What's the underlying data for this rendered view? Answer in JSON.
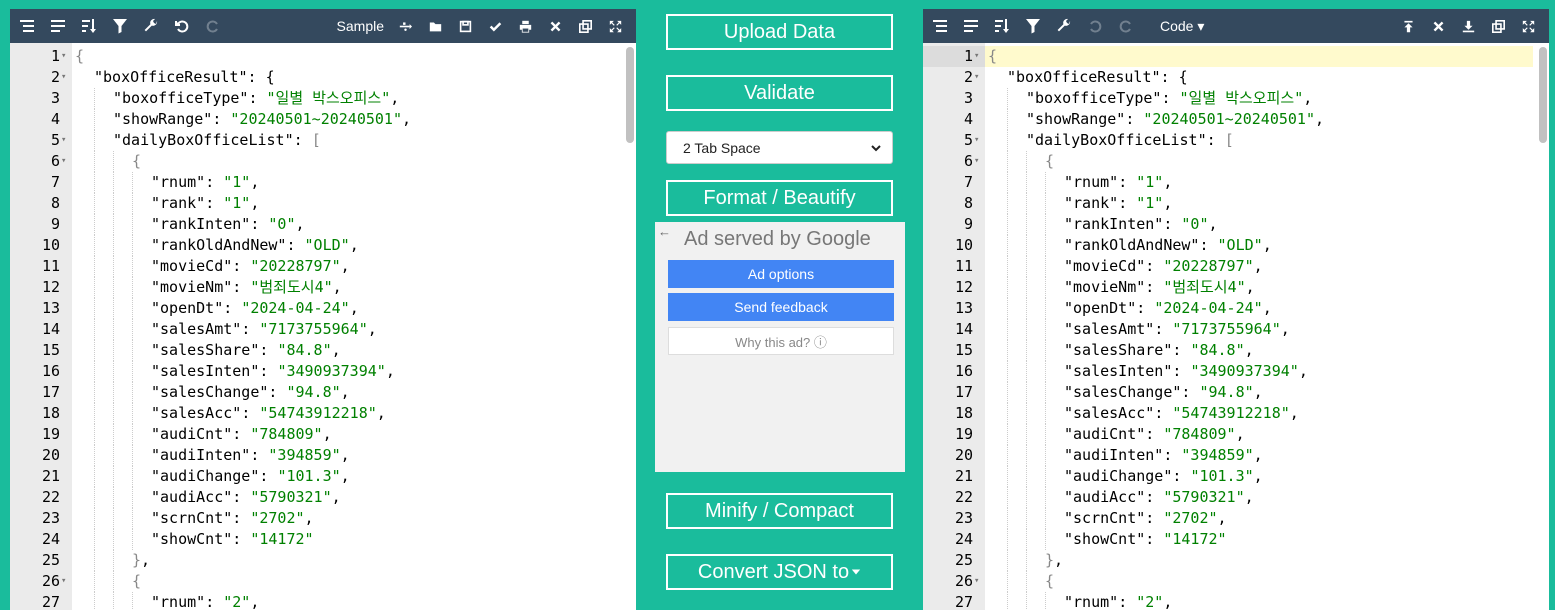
{
  "left_editor": {
    "title": "Sample",
    "toolbar_icons": [
      "format-icon",
      "compact-icon",
      "sort-icon",
      "filter-icon",
      "repair-icon",
      "undo-icon",
      "redo-icon"
    ],
    "right_icons": [
      "usb-icon",
      "open-folder-icon",
      "save-icon",
      "check-icon",
      "print-icon",
      "close-icon",
      "copy-icon",
      "fullscreen-icon"
    ]
  },
  "right_editor": {
    "mode_label": "Code",
    "toolbar_icons": [
      "format-icon",
      "compact-icon",
      "sort-icon",
      "filter-icon",
      "repair-icon",
      "undo-icon",
      "redo-icon"
    ],
    "right_icons": [
      "upload-icon",
      "close-icon",
      "download-icon",
      "copy-icon",
      "fullscreen-icon"
    ]
  },
  "middle": {
    "upload_label": "Upload Data",
    "validate_label": "Validate",
    "tab_select_value": "2 Tab Space",
    "format_label": "Format / Beautify",
    "minify_label": "Minify / Compact",
    "convert_label": "Convert JSON to"
  },
  "ad": {
    "title": "Ad served by Google",
    "options_label": "Ad options",
    "feedback_label": "Send feedback",
    "why_label": "Why this ad? ⓘ"
  },
  "colors": {
    "background": "#1abc9c",
    "toolbar": "#34495e",
    "string": "#008000",
    "ad_button": "#4285f4"
  },
  "code_lines": [
    {
      "n": "1",
      "fold": true,
      "indent": 0,
      "parts": [
        [
          "br",
          "{"
        ]
      ]
    },
    {
      "n": "2",
      "fold": true,
      "indent": 1,
      "parts": [
        [
          "k",
          "\"boxOfficeResult\""
        ],
        [
          "p",
          ": {"
        ]
      ]
    },
    {
      "n": "3",
      "fold": false,
      "indent": 2,
      "parts": [
        [
          "k",
          "\"boxofficeType\""
        ],
        [
          "p",
          ": "
        ],
        [
          "s",
          "\"일별 박스오피스\""
        ],
        [
          "p",
          ","
        ]
      ]
    },
    {
      "n": "4",
      "fold": false,
      "indent": 2,
      "parts": [
        [
          "k",
          "\"showRange\""
        ],
        [
          "p",
          ": "
        ],
        [
          "s",
          "\"20240501~20240501\""
        ],
        [
          "p",
          ","
        ]
      ]
    },
    {
      "n": "5",
      "fold": true,
      "indent": 2,
      "parts": [
        [
          "k",
          "\"dailyBoxOfficeList\""
        ],
        [
          "p",
          ": "
        ],
        [
          "br",
          "["
        ]
      ]
    },
    {
      "n": "6",
      "fold": true,
      "indent": 3,
      "parts": [
        [
          "br",
          "{"
        ]
      ]
    },
    {
      "n": "7",
      "fold": false,
      "indent": 4,
      "parts": [
        [
          "k",
          "\"rnum\""
        ],
        [
          "p",
          ": "
        ],
        [
          "s",
          "\"1\""
        ],
        [
          "p",
          ","
        ]
      ]
    },
    {
      "n": "8",
      "fold": false,
      "indent": 4,
      "parts": [
        [
          "k",
          "\"rank\""
        ],
        [
          "p",
          ": "
        ],
        [
          "s",
          "\"1\""
        ],
        [
          "p",
          ","
        ]
      ]
    },
    {
      "n": "9",
      "fold": false,
      "indent": 4,
      "parts": [
        [
          "k",
          "\"rankInten\""
        ],
        [
          "p",
          ": "
        ],
        [
          "s",
          "\"0\""
        ],
        [
          "p",
          ","
        ]
      ]
    },
    {
      "n": "10",
      "fold": false,
      "indent": 4,
      "parts": [
        [
          "k",
          "\"rankOldAndNew\""
        ],
        [
          "p",
          ": "
        ],
        [
          "s",
          "\"OLD\""
        ],
        [
          "p",
          ","
        ]
      ]
    },
    {
      "n": "11",
      "fold": false,
      "indent": 4,
      "parts": [
        [
          "k",
          "\"movieCd\""
        ],
        [
          "p",
          ": "
        ],
        [
          "s",
          "\"20228797\""
        ],
        [
          "p",
          ","
        ]
      ]
    },
    {
      "n": "12",
      "fold": false,
      "indent": 4,
      "parts": [
        [
          "k",
          "\"movieNm\""
        ],
        [
          "p",
          ": "
        ],
        [
          "s",
          "\"범죄도시4\""
        ],
        [
          "p",
          ","
        ]
      ]
    },
    {
      "n": "13",
      "fold": false,
      "indent": 4,
      "parts": [
        [
          "k",
          "\"openDt\""
        ],
        [
          "p",
          ": "
        ],
        [
          "s",
          "\"2024-04-24\""
        ],
        [
          "p",
          ","
        ]
      ]
    },
    {
      "n": "14",
      "fold": false,
      "indent": 4,
      "parts": [
        [
          "k",
          "\"salesAmt\""
        ],
        [
          "p",
          ": "
        ],
        [
          "s",
          "\"7173755964\""
        ],
        [
          "p",
          ","
        ]
      ]
    },
    {
      "n": "15",
      "fold": false,
      "indent": 4,
      "parts": [
        [
          "k",
          "\"salesShare\""
        ],
        [
          "p",
          ": "
        ],
        [
          "s",
          "\"84.8\""
        ],
        [
          "p",
          ","
        ]
      ]
    },
    {
      "n": "16",
      "fold": false,
      "indent": 4,
      "parts": [
        [
          "k",
          "\"salesInten\""
        ],
        [
          "p",
          ": "
        ],
        [
          "s",
          "\"3490937394\""
        ],
        [
          "p",
          ","
        ]
      ]
    },
    {
      "n": "17",
      "fold": false,
      "indent": 4,
      "parts": [
        [
          "k",
          "\"salesChange\""
        ],
        [
          "p",
          ": "
        ],
        [
          "s",
          "\"94.8\""
        ],
        [
          "p",
          ","
        ]
      ]
    },
    {
      "n": "18",
      "fold": false,
      "indent": 4,
      "parts": [
        [
          "k",
          "\"salesAcc\""
        ],
        [
          "p",
          ": "
        ],
        [
          "s",
          "\"54743912218\""
        ],
        [
          "p",
          ","
        ]
      ]
    },
    {
      "n": "19",
      "fold": false,
      "indent": 4,
      "parts": [
        [
          "k",
          "\"audiCnt\""
        ],
        [
          "p",
          ": "
        ],
        [
          "s",
          "\"784809\""
        ],
        [
          "p",
          ","
        ]
      ]
    },
    {
      "n": "20",
      "fold": false,
      "indent": 4,
      "parts": [
        [
          "k",
          "\"audiInten\""
        ],
        [
          "p",
          ": "
        ],
        [
          "s",
          "\"394859\""
        ],
        [
          "p",
          ","
        ]
      ]
    },
    {
      "n": "21",
      "fold": false,
      "indent": 4,
      "parts": [
        [
          "k",
          "\"audiChange\""
        ],
        [
          "p",
          ": "
        ],
        [
          "s",
          "\"101.3\""
        ],
        [
          "p",
          ","
        ]
      ]
    },
    {
      "n": "22",
      "fold": false,
      "indent": 4,
      "parts": [
        [
          "k",
          "\"audiAcc\""
        ],
        [
          "p",
          ": "
        ],
        [
          "s",
          "\"5790321\""
        ],
        [
          "p",
          ","
        ]
      ]
    },
    {
      "n": "23",
      "fold": false,
      "indent": 4,
      "parts": [
        [
          "k",
          "\"scrnCnt\""
        ],
        [
          "p",
          ": "
        ],
        [
          "s",
          "\"2702\""
        ],
        [
          "p",
          ","
        ]
      ]
    },
    {
      "n": "24",
      "fold": false,
      "indent": 4,
      "parts": [
        [
          "k",
          "\"showCnt\""
        ],
        [
          "p",
          ": "
        ],
        [
          "s",
          "\"14172\""
        ]
      ]
    },
    {
      "n": "25",
      "fold": false,
      "indent": 3,
      "parts": [
        [
          "br",
          "}"
        ],
        [
          "p",
          ","
        ]
      ]
    },
    {
      "n": "26",
      "fold": true,
      "indent": 3,
      "parts": [
        [
          "br",
          "{"
        ]
      ]
    },
    {
      "n": "27",
      "fold": false,
      "indent": 4,
      "parts": [
        [
          "k",
          "\"rnum\""
        ],
        [
          "p",
          ": "
        ],
        [
          "s",
          "\"2\""
        ],
        [
          "p",
          ","
        ]
      ]
    }
  ]
}
